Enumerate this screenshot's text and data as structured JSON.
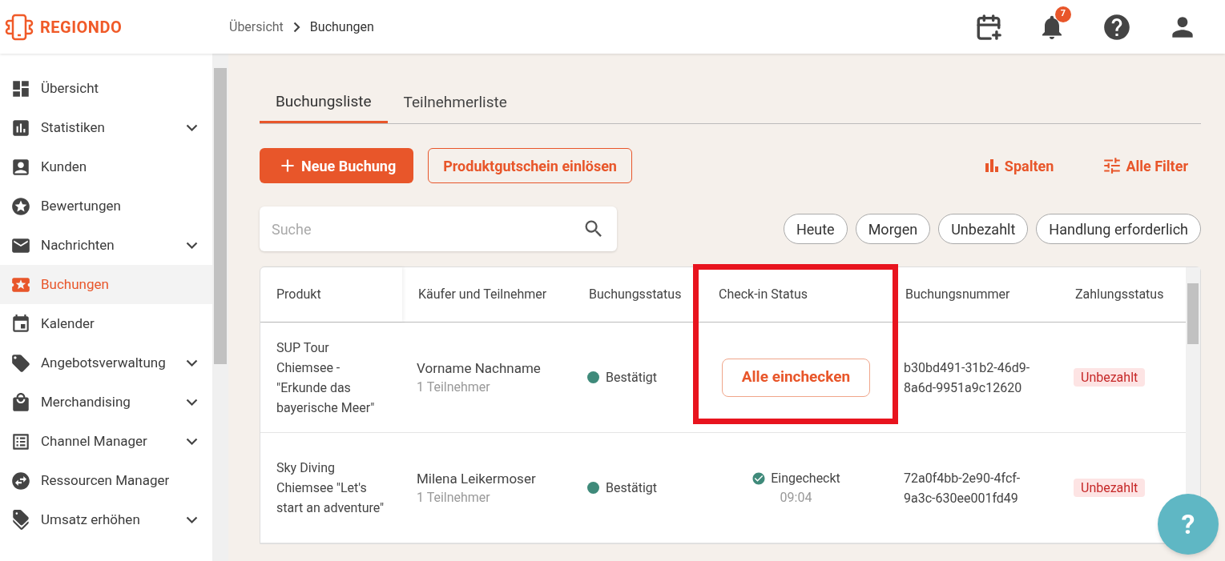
{
  "header": {
    "logo": "REGIONDO",
    "breadcrumb": [
      "Übersicht",
      "Buchungen"
    ],
    "notification_count": "7"
  },
  "sidebar": {
    "items": [
      {
        "label": "Übersicht",
        "selected": false,
        "has_submenu": false
      },
      {
        "label": "Statistiken",
        "selected": false,
        "has_submenu": true
      },
      {
        "label": "Kunden",
        "selected": false,
        "has_submenu": false
      },
      {
        "label": "Bewertungen",
        "selected": false,
        "has_submenu": false
      },
      {
        "label": "Nachrichten",
        "selected": false,
        "has_submenu": true
      },
      {
        "label": "Buchungen",
        "selected": true,
        "has_submenu": false
      },
      {
        "label": "Kalender",
        "selected": false,
        "has_submenu": false
      },
      {
        "label": "Angebotsverwaltung",
        "selected": false,
        "has_submenu": true
      },
      {
        "label": "Merchandising",
        "selected": false,
        "has_submenu": true
      },
      {
        "label": "Channel Manager",
        "selected": false,
        "has_submenu": true
      },
      {
        "label": "Ressourcen Manager",
        "selected": false,
        "has_submenu": false
      },
      {
        "label": "Umsatz erhöhen",
        "selected": false,
        "has_submenu": true
      }
    ]
  },
  "tabs": [
    {
      "label": "Buchungsliste",
      "selected": true
    },
    {
      "label": "Teilnehmerliste",
      "selected": false
    }
  ],
  "actions": {
    "new_booking": "Neue Buchung",
    "redeem_voucher": "Produktgutschein einlösen",
    "columns": "Spalten",
    "filters": "Alle Filter"
  },
  "search": {
    "placeholder": "Suche"
  },
  "quick_filters": [
    "Heute",
    "Morgen",
    "Unbezahlt",
    "Handlung erforderlich"
  ],
  "table": {
    "columns": [
      {
        "label": "Produkt",
        "highlighted": false
      },
      {
        "label": "Käufer und Teilnehmer",
        "highlighted": false
      },
      {
        "label": "Buchungsstatus",
        "highlighted": false
      },
      {
        "label": "Check-in Status",
        "highlighted": true
      },
      {
        "label": "Buchungsnummer",
        "highlighted": false
      },
      {
        "label": "Zahlungsstatus",
        "highlighted": false
      }
    ],
    "rows": [
      {
        "product": "SUP Tour Chiemsee - \"Erkunde das bayerische Meer\"",
        "buyer": "Vorname Nachname",
        "participants": "1 Teilnehmer",
        "booking_status": "Bestätigt",
        "color": "#3f8a7a",
        "checkin": {
          "kind": "button",
          "label": "Alle einchecken"
        },
        "booking_number": "b30bd491-31b2-46d9-8a6d-9951a9c12620",
        "payment_status": "Unbezahlt"
      },
      {
        "product": "Sky Diving Chiemsee \"Let's start an adventure\"",
        "buyer": "Milena Leikermoser",
        "participants": "1 Teilnehmer",
        "booking_status": "Bestätigt",
        "color": "#3f8a7a",
        "checkin": {
          "kind": "checked_in",
          "label": "Eingecheckt",
          "time": "09:04"
        },
        "booking_number": "72a0f4bb-2e90-4fcf-9a3c-630ee001fd49",
        "payment_status": "Unbezahlt"
      }
    ]
  },
  "help_button": {
    "label": "?"
  }
}
